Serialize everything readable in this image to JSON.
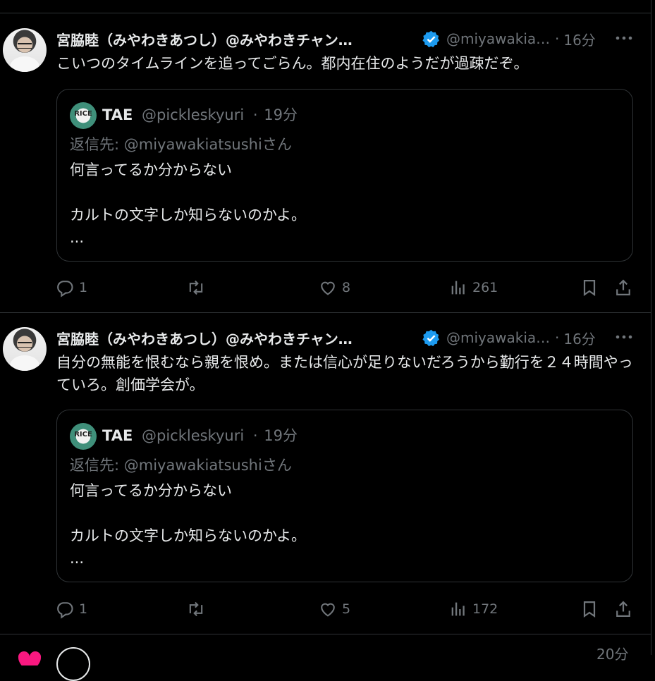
{
  "tweets": [
    {
      "author_name": "宮脇睦（みやわきあつし）@みやわきチャン…",
      "handle": "@miyawakia…",
      "time": "16分",
      "text": "こいつのタイムラインを追ってごらん。都内在住のようだが過疎だぞ。",
      "quote": {
        "avatar_text": "RICE",
        "name": "TAE",
        "handle": "@pickleskyuri",
        "time": "19分",
        "reply_to": "返信先: @miyawakiatsushiさん",
        "line1": "何言ってるか分からない",
        "line2": "カルトの文字しか知らないのかよ。",
        "line3": "..."
      },
      "actions": {
        "replies": "1",
        "retweets": "",
        "likes": "8",
        "views": "261"
      }
    },
    {
      "author_name": "宮脇睦（みやわきあつし）@みやわきチャン…",
      "handle": "@miyawakia…",
      "time": "16分",
      "text": "自分の無能を恨むなら親を恨め。または信心が足りないだろうから勤行を２４時間やっていろ。創価学会が。",
      "quote": {
        "avatar_text": "RICE",
        "name": "TAE",
        "handle": "@pickleskyuri",
        "time": "19分",
        "reply_to": "返信先: @miyawakiatsushiさん",
        "line1": "何言ってるか分からない",
        "line2": "カルトの文字しか知らないのかよ。",
        "line3": "..."
      },
      "actions": {
        "replies": "1",
        "retweets": "",
        "likes": "5",
        "views": "172"
      }
    }
  ],
  "separator": "·",
  "partial": {
    "time": "20分"
  },
  "colors": {
    "background": "#000000",
    "text": "#e7e9ea",
    "secondary": "#71767b",
    "border": "#2f3336",
    "verified": "#1d9bf0",
    "like_pink": "#f91880"
  },
  "icons": [
    "verified-badge-icon",
    "more-icon",
    "reply-icon",
    "retweet-icon",
    "like-icon",
    "views-icon",
    "bookmark-icon",
    "share-icon"
  ]
}
